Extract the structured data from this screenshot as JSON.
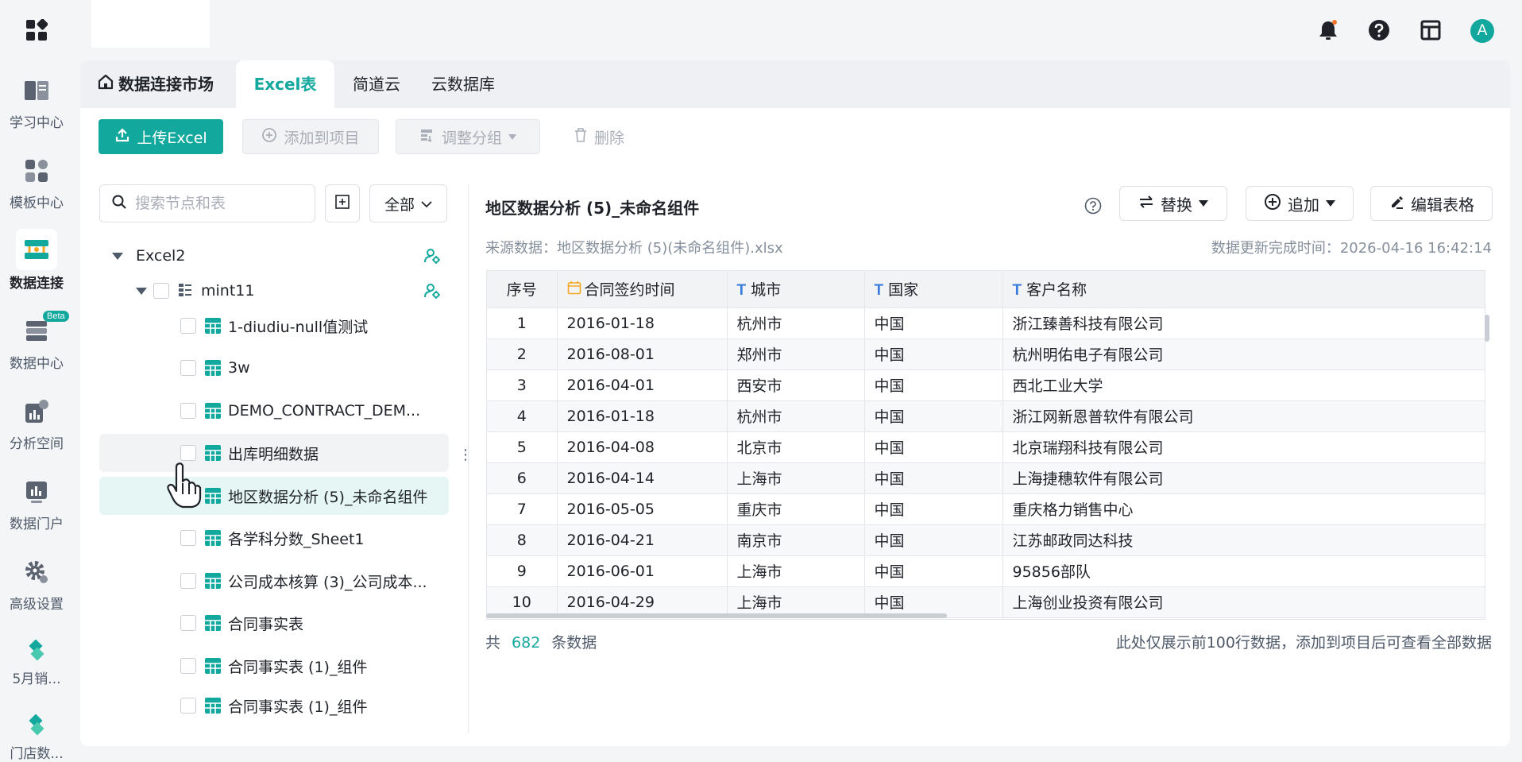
{
  "topbar": {
    "icons": [
      "apps-grid-icon",
      "bell-icon",
      "help-icon",
      "layout-icon"
    ],
    "avatar_letter": "A",
    "accent_color": "#13a89e"
  },
  "leftnav": {
    "items": [
      {
        "label": "学习中心",
        "icon": "book-icon"
      },
      {
        "label": "模板中心",
        "icon": "template-icon"
      },
      {
        "label": "数据连接",
        "icon": "data-connect-icon",
        "active": true
      },
      {
        "label": "数据中心",
        "icon": "database-icon",
        "badge": "Beta"
      },
      {
        "label": "分析空间",
        "icon": "analysis-icon"
      },
      {
        "label": "数据门户",
        "icon": "portal-icon"
      },
      {
        "label": "高级设置",
        "icon": "gear-icon"
      },
      {
        "label": "5月销...",
        "icon": "diamond-icon"
      },
      {
        "label": "门店数...",
        "icon": "diamond-icon"
      }
    ]
  },
  "tabs": [
    {
      "label": "数据连接市场",
      "icon": "home-icon"
    },
    {
      "label": "Excel表",
      "active": true
    },
    {
      "label": "简道云"
    },
    {
      "label": "云数据库"
    }
  ],
  "toolbar": {
    "upload": "上传Excel",
    "add_to_project": "添加到项目",
    "adjust_group": "调整分组",
    "delete": "删除"
  },
  "tree_panel": {
    "search_placeholder": "搜索节点和表",
    "filter_value": "全部",
    "nodes": [
      {
        "label": "Excel2",
        "level": 0,
        "type": "group"
      },
      {
        "label": "mint11",
        "level": 1,
        "type": "folder"
      },
      {
        "label": "1-diudiu-null值测试",
        "level": 2,
        "type": "sheet"
      },
      {
        "label": "3w",
        "level": 2,
        "type": "sheet"
      },
      {
        "label": "DEMO_CONTRACT_DEM...",
        "level": 2,
        "type": "sheet"
      },
      {
        "label": "出库明细数据",
        "level": 2,
        "type": "sheet",
        "state": "hover"
      },
      {
        "label": "地区数据分析 (5)_未命名组件",
        "level": 2,
        "type": "sheet",
        "state": "selected"
      },
      {
        "label": "各学科分数_Sheet1",
        "level": 2,
        "type": "sheet"
      },
      {
        "label": "公司成本核算 (3)_公司成本...",
        "level": 2,
        "type": "sheet"
      },
      {
        "label": "合同事实表",
        "level": 2,
        "type": "sheet"
      },
      {
        "label": "合同事实表 (1)_组件",
        "level": 2,
        "type": "sheet"
      },
      {
        "label": "合同事实表 (1)_组件",
        "level": 2,
        "type": "sheet"
      }
    ]
  },
  "detail": {
    "title": "地区数据分析 (5)_未命名组件",
    "replace": "替换",
    "append": "追加",
    "edit_table": "编辑表格",
    "source": "来源数据：地区数据分析 (5)(未命名组件).xlsx",
    "update_time": "数据更新完成时间：2026-04-16 16:42:14",
    "table": {
      "headers": [
        {
          "label": "序号",
          "type": ""
        },
        {
          "label": "合同签约时间",
          "type": "date"
        },
        {
          "label": "城市",
          "type": "T"
        },
        {
          "label": "国家",
          "type": "T"
        },
        {
          "label": "客户名称",
          "type": "T"
        }
      ],
      "rows": [
        [
          "1",
          "2016-01-18",
          "杭州市",
          "中国",
          "浙江臻善科技有限公司"
        ],
        [
          "2",
          "2016-08-01",
          "郑州市",
          "中国",
          "杭州明佑电子有限公司"
        ],
        [
          "3",
          "2016-04-01",
          "西安市",
          "中国",
          "西北工业大学"
        ],
        [
          "4",
          "2016-01-18",
          "杭州市",
          "中国",
          "浙江网新恩普软件有限公司"
        ],
        [
          "5",
          "2016-04-08",
          "北京市",
          "中国",
          "北京瑞翔科技有限公司"
        ],
        [
          "6",
          "2016-04-14",
          "上海市",
          "中国",
          "上海捷穗软件有限公司"
        ],
        [
          "7",
          "2016-05-05",
          "重庆市",
          "中国",
          "重庆格力销售中心"
        ],
        [
          "8",
          "2016-04-21",
          "南京市",
          "中国",
          "江苏邮政同达科技"
        ],
        [
          "9",
          "2016-06-01",
          "上海市",
          "中国",
          "95856部队"
        ],
        [
          "10",
          "2016-04-29",
          "上海市",
          "中国",
          "上海创业投资有限公司"
        ]
      ]
    },
    "footer": {
      "prefix": "共",
      "count": "682",
      "suffix": "条数据",
      "note": "此处仅展示前100行数据，添加到项目后可查看全部数据"
    }
  }
}
